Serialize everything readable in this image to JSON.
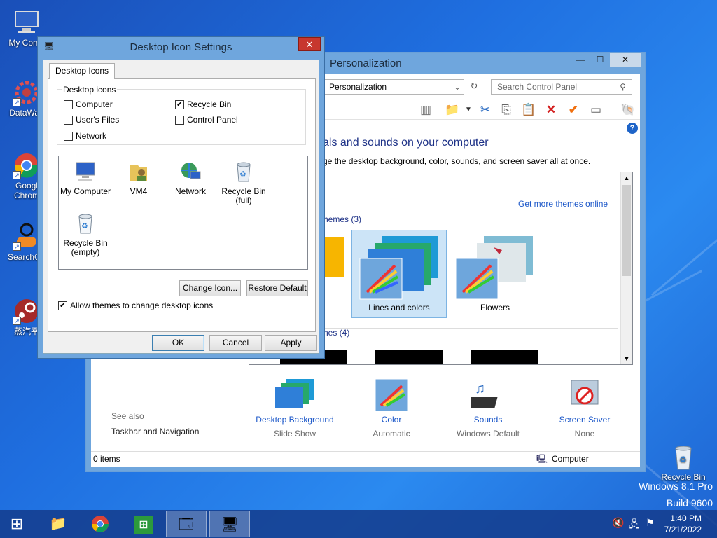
{
  "desktop": {
    "icons": [
      {
        "label": "My Comp"
      },
      {
        "label": "DataWag"
      },
      {
        "label": "Googl Chrom"
      },
      {
        "label": "SearchGa"
      },
      {
        "label": "蒸汽平"
      }
    ],
    "recycle_bin_label": "Recycle Bin",
    "watermark_line1": "Windows 8.1 Pro",
    "watermark_line2": "Build 9600"
  },
  "personalization": {
    "title": "Personalization",
    "address": "Personalization",
    "search_placeholder": "Search Control Panel",
    "heading": "als and sounds on your computer",
    "subheading": "ge the desktop background, color, sounds, and screen saver all at once.",
    "get_more_themes": "Get more themes online",
    "group1_label": "hemes (3)",
    "group2_label": "nes (4)",
    "themes": [
      {
        "name": "Lines and colors",
        "selected": true
      },
      {
        "name": "Flowers",
        "selected": false
      }
    ],
    "see_also": "See also",
    "taskbar_link": "Taskbar and Navigation",
    "bottom_items": [
      {
        "label": "Desktop Background",
        "sub": "Slide Show"
      },
      {
        "label": "Color",
        "sub": "Automatic"
      },
      {
        "label": "Sounds",
        "sub": "Windows Default"
      },
      {
        "label": "Screen Saver",
        "sub": "None"
      }
    ],
    "status_items": "0 items",
    "status_location": "Computer"
  },
  "dialog": {
    "title": "Desktop Icon Settings",
    "tab": "Desktop Icons",
    "group_label": "Desktop icons",
    "checkboxes": [
      {
        "label": "Computer",
        "checked": false
      },
      {
        "label": "Recycle Bin",
        "checked": true
      },
      {
        "label": "User's Files",
        "checked": false
      },
      {
        "label": "Control Panel",
        "checked": false
      },
      {
        "label": "Network",
        "checked": false
      }
    ],
    "icon_items": [
      {
        "label": "My Computer"
      },
      {
        "label": "VM4"
      },
      {
        "label": "Network"
      },
      {
        "label": "Recycle Bin\n(full)"
      },
      {
        "label": "Recycle Bin\n(empty)"
      }
    ],
    "change_icon": "Change Icon...",
    "restore_default": "Restore Default",
    "allow_themes": "Allow themes to change desktop icons",
    "allow_themes_checked": true,
    "ok": "OK",
    "cancel": "Cancel",
    "apply": "Apply"
  },
  "taskbar": {
    "time": "1:40 PM",
    "date": "7/21/2022"
  },
  "colors": {
    "link": "#1a56c8",
    "heading": "#1e3287",
    "title_bar": "#6fa6dd",
    "close": "#c7372e"
  }
}
